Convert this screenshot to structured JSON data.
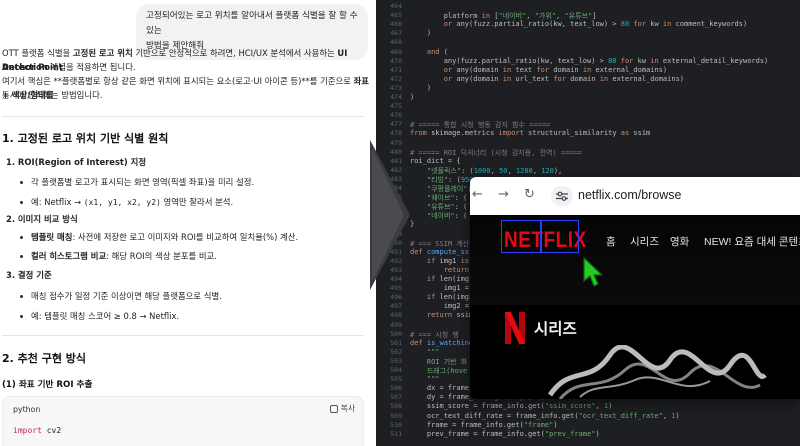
{
  "chat": {
    "user_bubble": [
      "고정되어있는 로고 위치를 알아내서 플랫폼 식별을 잘 할 수 있는",
      "방법을 제안해줘"
    ],
    "intro": {
      "p1a": "OTT 플랫폼 식별을 ",
      "p1b": "고정된 로고 위치",
      "p1c": " 기반으로 안정적으로 하려면, HCI/UX 분석에서 사용하는 ",
      "p1d": "UI Anchor Point",
      "p2a": "Detection",
      "p2b": " 개념을 적용하면 됩니다.",
      "p3a": "여기서 핵심은 **플랫폼별로 항상 같은 화면 위치에 표시되는 요소(로고·UI 아이콘 등)**를 기준으로 ",
      "p3b": "좌표 + 색상/형태를",
      "p4": "동시에 인식하는 방법입니다."
    },
    "section1": "1. 고정된 로고 위치 기반 식별 원칙",
    "s1_items": {
      "roi_title": "1.  ROI(Region of Interest) 지정",
      "roi_b1": "각 플랫폼별 로고가 표시되는 화면 영역(픽셀 좌표)을 미리 설정.",
      "roi_b2_a": "예: Netflix → ",
      "roi_b2_b": "(x1, y1, x2, y2)",
      "roi_b2_c": " 영역만 잘라서 분석.",
      "cmp_title": "2.  이미지 비교 방식",
      "cmp_b1_a": "템플릿 매칭",
      "cmp_b1_b": ": 사전에 저장한 로고 이미지와 ROI를 비교하여 일치율(%) 계산.",
      "cmp_b2_a": "컬러 히스토그램 비교",
      "cmp_b2_b": ": 해당 ROI의 색상 분포를 비교.",
      "dec_title": "3.  결정 기준",
      "dec_b1": "매칭 점수가 일정 기준 이상이면 해당 플랫폼으로 식별.",
      "dec_b2": "예: 템플릿 매칭 스코어 ≥ 0.8 → Netflix."
    },
    "section2": "2. 추천 구현 방식",
    "sub1": "(1) 좌표 기반 ROI 추출",
    "code_card": {
      "lang": "python",
      "copy": "복사",
      "line1_kw": "import",
      "line1_mod": " cv2"
    }
  },
  "editor": {
    "lines": [
      {
        "n": "464",
        "t": [
          [
            "",
            ""
          ]
        ]
      },
      {
        "n": "465",
        "t": [
          [
            "        platform ",
            "p"
          ],
          [
            "in",
            "kw"
          ],
          [
            " [",
            "p"
          ],
          [
            "\"네이버\"",
            "str"
          ],
          [
            ", ",
            "p"
          ],
          [
            "\"가위\"",
            "str"
          ],
          [
            ", ",
            "p"
          ],
          [
            "\"유튜브\"",
            "str"
          ],
          [
            "]",
            "p"
          ]
        ]
      },
      {
        "n": "466",
        "t": [
          [
            "        ",
            "p"
          ],
          [
            "or",
            "kw"
          ],
          [
            " any(fuzz.partial_ratio(kw, text_low) > ",
            "p"
          ],
          [
            "80",
            "num"
          ],
          [
            " ",
            "p"
          ],
          [
            "for",
            "kw"
          ],
          [
            " kw ",
            "p"
          ],
          [
            "in",
            "kw"
          ],
          [
            " comment_keywords)",
            "p"
          ]
        ]
      },
      {
        "n": "467",
        "t": [
          [
            "    )",
            "p"
          ]
        ]
      },
      {
        "n": "468",
        "t": [
          [
            "",
            ""
          ]
        ]
      },
      {
        "n": "469",
        "t": [
          [
            "    ",
            "p"
          ],
          [
            "and",
            "kw"
          ],
          [
            " (",
            "p"
          ]
        ]
      },
      {
        "n": "470",
        "t": [
          [
            "        any(fuzz.partial_ratio(kw, text_low) > ",
            "p"
          ],
          [
            "80",
            "num"
          ],
          [
            " ",
            "p"
          ],
          [
            "for",
            "kw"
          ],
          [
            " kw ",
            "p"
          ],
          [
            "in",
            "kw"
          ],
          [
            " external_detail_keywords)",
            "p"
          ]
        ]
      },
      {
        "n": "471",
        "t": [
          [
            "        ",
            "p"
          ],
          [
            "or",
            "kw"
          ],
          [
            " any(domain ",
            "p"
          ],
          [
            "in",
            "kw"
          ],
          [
            " text ",
            "p"
          ],
          [
            "for",
            "kw"
          ],
          [
            " domain ",
            "p"
          ],
          [
            "in",
            "kw"
          ],
          [
            " external_domains)",
            "p"
          ]
        ]
      },
      {
        "n": "472",
        "t": [
          [
            "        ",
            "p"
          ],
          [
            "or",
            "kw"
          ],
          [
            " any(domain ",
            "p"
          ],
          [
            "in",
            "kw"
          ],
          [
            " url_text ",
            "p"
          ],
          [
            "for",
            "kw"
          ],
          [
            " domain ",
            "p"
          ],
          [
            "in",
            "kw"
          ],
          [
            " external_domains)",
            "p"
          ]
        ]
      },
      {
        "n": "473",
        "t": [
          [
            "    )",
            "p"
          ]
        ]
      },
      {
        "n": "474",
        "t": [
          [
            ")",
            "p"
          ]
        ]
      },
      {
        "n": "475",
        "t": [
          [
            "",
            ""
          ]
        ]
      },
      {
        "n": "476",
        "t": [
          [
            "",
            ""
          ]
        ]
      },
      {
        "n": "477",
        "t": [
          [
            "# ===== 통합 시청 행동 감지 함수 =====",
            "cm"
          ]
        ]
      },
      {
        "n": "478",
        "t": [
          [
            "from",
            "kw"
          ],
          [
            " skimage.metrics ",
            "p"
          ],
          [
            "import",
            "kw"
          ],
          [
            " structural_similarity ",
            "p"
          ],
          [
            "as",
            "kw"
          ],
          [
            " ssim",
            "p"
          ]
        ]
      },
      {
        "n": "479",
        "t": [
          [
            "",
            ""
          ]
        ]
      },
      {
        "n": "480",
        "t": [
          [
            "# ===== ROI 딕셔너리 (시청 감지용, 전역) =====",
            "cm"
          ]
        ]
      },
      {
        "n": "481",
        "t": [
          [
            "roi_dict = {",
            "p"
          ]
        ]
      },
      {
        "n": "482",
        "t": [
          [
            "    ",
            "p"
          ],
          [
            "\"넷플릭스\"",
            "str"
          ],
          [
            ": (",
            "p"
          ],
          [
            "1000",
            "num"
          ],
          [
            ", ",
            "p"
          ],
          [
            "50",
            "num"
          ],
          [
            ", ",
            "p"
          ],
          [
            "1280",
            "num"
          ],
          [
            ", ",
            "p"
          ],
          [
            "120",
            "num"
          ],
          [
            "),",
            "p"
          ]
        ]
      },
      {
        "n": "483",
        "t": [
          [
            "    ",
            "p"
          ],
          [
            "\"티빙\"",
            "str"
          ],
          [
            ": (",
            "p"
          ],
          [
            "950",
            "num"
          ],
          [
            ", ",
            "p"
          ],
          [
            "20",
            "num"
          ],
          [
            ", ",
            "p"
          ],
          [
            "1250",
            "num"
          ],
          [
            ", ",
            "p"
          ],
          [
            "80",
            "num"
          ],
          [
            "),",
            "p"
          ]
        ]
      },
      {
        "n": "484",
        "t": [
          [
            "    ",
            "p"
          ],
          [
            "\"쿠팡플레이\"",
            "str"
          ],
          [
            ": (",
            "p"
          ]
        ]
      },
      {
        "n": "485",
        "t": [
          [
            "    ",
            "p"
          ],
          [
            "\"웨이브\"",
            "str"
          ],
          [
            ": (",
            "p"
          ]
        ]
      },
      {
        "n": "486",
        "t": [
          [
            "    ",
            "p"
          ],
          [
            "\"유튜브\"",
            "str"
          ],
          [
            ": (",
            "p"
          ]
        ]
      },
      {
        "n": "487",
        "t": [
          [
            "    ",
            "p"
          ],
          [
            "\"네이버\"",
            "str"
          ],
          [
            ": (",
            "p"
          ]
        ]
      },
      {
        "n": "488",
        "t": [
          [
            "}",
            "p"
          ]
        ]
      },
      {
        "n": "489",
        "t": [
          [
            "",
            ""
          ]
        ]
      },
      {
        "n": "490",
        "t": [
          [
            "# === SSIM 계산",
            "cm"
          ]
        ]
      },
      {
        "n": "491",
        "t": [
          [
            "def",
            "kw"
          ],
          [
            " ",
            "p"
          ],
          [
            "compute_ssim",
            "fn"
          ]
        ]
      },
      {
        "n": "492",
        "t": [
          [
            "    ",
            "p"
          ],
          [
            "if",
            "kw"
          ],
          [
            " img1 ",
            "p"
          ],
          [
            "is",
            "kw"
          ]
        ]
      },
      {
        "n": "493",
        "t": [
          [
            "        ",
            "p"
          ],
          [
            "return",
            "kw"
          ]
        ]
      },
      {
        "n": "494",
        "t": [
          [
            "    ",
            "p"
          ],
          [
            "if",
            "kw"
          ],
          [
            " len(img1",
            "p"
          ]
        ]
      },
      {
        "n": "495",
        "t": [
          [
            "        img1 =",
            "p"
          ]
        ]
      },
      {
        "n": "496",
        "t": [
          [
            "    ",
            "p"
          ],
          [
            "if",
            "kw"
          ],
          [
            " len(img2",
            "p"
          ]
        ]
      },
      {
        "n": "497",
        "t": [
          [
            "        img2 =",
            "p"
          ]
        ]
      },
      {
        "n": "498",
        "t": [
          [
            "    ",
            "p"
          ],
          [
            "return",
            "kw"
          ],
          [
            " ssim",
            "p"
          ]
        ]
      },
      {
        "n": "499",
        "t": [
          [
            "",
            ""
          ]
        ]
      },
      {
        "n": "500",
        "t": [
          [
            "# === 시청 행",
            "cm"
          ]
        ]
      },
      {
        "n": "501",
        "t": [
          [
            "def",
            "kw"
          ],
          [
            " ",
            "p"
          ],
          [
            "is_watching",
            "fn"
          ]
        ]
      },
      {
        "n": "502",
        "t": [
          [
            "    ",
            "p"
          ],
          [
            "\"\"\"",
            "str"
          ]
        ]
      },
      {
        "n": "503",
        "t": [
          [
            "    ROI 기반 화",
            "str"
          ]
        ]
      },
      {
        "n": "504",
        "t": [
          [
            "    드래그(hove",
            "str"
          ]
        ]
      },
      {
        "n": "505",
        "t": [
          [
            "    ",
            "p"
          ],
          [
            "\"\"\"",
            "str"
          ]
        ]
      },
      {
        "n": "506",
        "t": [
          [
            "    dx = frame_",
            "p"
          ]
        ]
      },
      {
        "n": "507",
        "t": [
          [
            "    dy = frame_info.get(",
            "p"
          ],
          [
            "\"dy\"",
            "str"
          ],
          [
            ", ",
            "p"
          ],
          [
            "0",
            "num"
          ],
          [
            ")",
            "p"
          ]
        ]
      },
      {
        "n": "508",
        "t": [
          [
            "    ssim_score = frame_info.get(",
            "p"
          ],
          [
            "\"ssim_score\"",
            "str"
          ],
          [
            ", ",
            "p"
          ],
          [
            "1",
            "num"
          ],
          [
            ")",
            "p"
          ]
        ]
      },
      {
        "n": "509",
        "t": [
          [
            "    ocr_text_diff_rate = frame_info.get(",
            "p"
          ],
          [
            "\"ocr_text_diff_rate\"",
            "str"
          ],
          [
            ", ",
            "p"
          ],
          [
            "1",
            "num"
          ],
          [
            ")",
            "p"
          ]
        ]
      },
      {
        "n": "510",
        "t": [
          [
            "    frame = frame_info.get(",
            "p"
          ],
          [
            "\"frame\"",
            "str"
          ],
          [
            ")",
            "p"
          ]
        ]
      },
      {
        "n": "511",
        "t": [
          [
            "    prev_frame = frame_info.get(",
            "p"
          ],
          [
            "\"prev_frame\"",
            "str"
          ],
          [
            ")",
            "p"
          ]
        ]
      }
    ]
  },
  "browser": {
    "url": "netflix.com/browse",
    "back_icon": "←",
    "forward_icon": "→",
    "reload_icon": "↻",
    "logo": "NETFLIX",
    "nav": [
      "홈",
      "시리즈",
      "영화",
      "NEW! 요즘 대세 콘텐츠"
    ],
    "hero_label": "시리즈",
    "colors": {
      "netflix_red": "#e50914",
      "roi_box": "#2b3dff",
      "cursor": "#22cc22"
    }
  }
}
